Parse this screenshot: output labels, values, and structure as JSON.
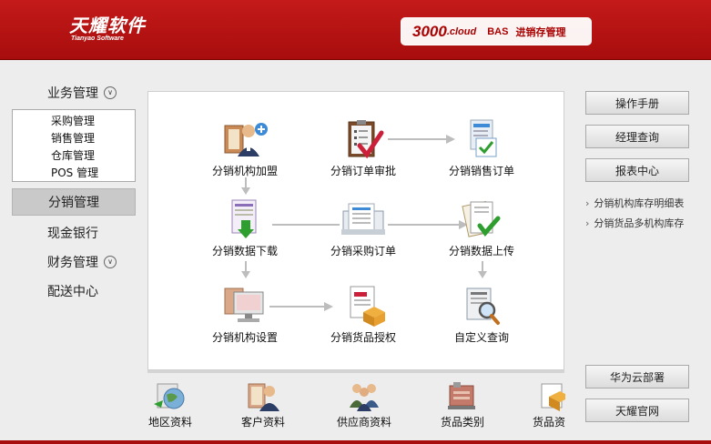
{
  "header": {
    "logo_cn": "天耀软件",
    "logo_en": "Tianyao Software",
    "product_num": "3000",
    "product_cloud": ".cloud",
    "product_bas": "BAS",
    "product_sub": "进销存管理"
  },
  "sidebar": {
    "business": "业务管理",
    "business_items": [
      "采购管理",
      "销售管理",
      "仓库管理",
      "POS 管理"
    ],
    "distribution": "分销管理",
    "cash_bank": "现金银行",
    "finance": "财务管理",
    "delivery": "配送中心"
  },
  "flow": {
    "join": "分销机构加盟",
    "order_review": "分销订单审批",
    "sales_order": "分销销售订单",
    "data_download": "分销数据下载",
    "purchase_order": "分销采购订单",
    "data_upload": "分销数据上传",
    "org_settings": "分销机构设置",
    "goods_auth": "分销货品授权",
    "custom_query": "自定义查询"
  },
  "right": {
    "manual": "操作手册",
    "manager_query": "经理查询",
    "report_center": "报表中心",
    "link1": "分销机构库存明细表",
    "link2": "分销货品多机构库存",
    "huawei": "华为云部署",
    "official": "天耀官网"
  },
  "bottom": {
    "region": "地区资料",
    "customer": "客户资料",
    "supplier": "供应商资料",
    "category": "货品类别",
    "goods": "货品资"
  },
  "colors": {
    "header_red": "#b81414",
    "accent_green": "#2e9e2e",
    "check_red": "#cc1f3a"
  }
}
